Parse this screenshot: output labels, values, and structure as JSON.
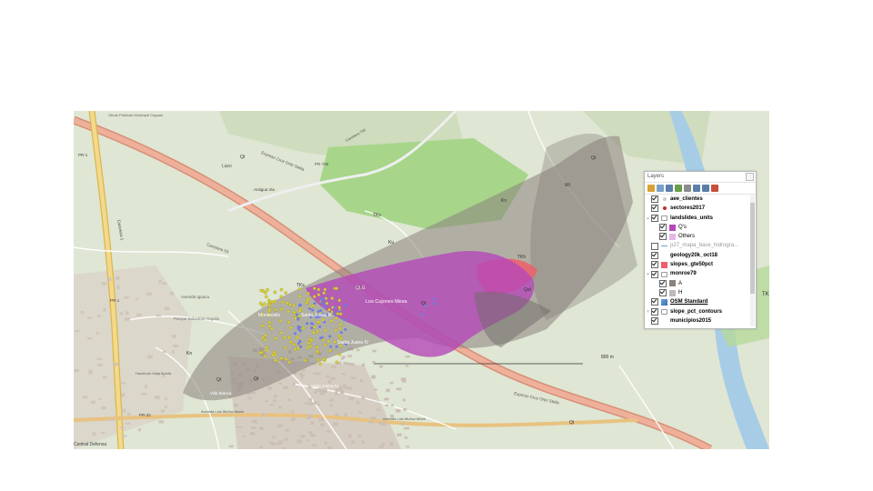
{
  "map": {
    "place_labels": [
      {
        "text": "Lazo"
      },
      {
        "text": "Antigua Via"
      },
      {
        "text": "Carretera 53"
      },
      {
        "text": "Expreso Cruz Ortiz Stella"
      },
      {
        "text": "Expreso Cruz Ortiz Stella"
      },
      {
        "text": "Avenida Iguaca"
      },
      {
        "text": "Parque Industrial Anguila"
      },
      {
        "text": "Montecielo"
      },
      {
        "text": "Santa Juana III"
      },
      {
        "text": "Santa Juana IV"
      },
      {
        "text": "Santa Juana Fy"
      },
      {
        "text": "Villa Blanca"
      },
      {
        "text": "Avenida Luis Muñoz Marín"
      },
      {
        "text": "Avenida Luis Muñoz Marín"
      },
      {
        "text": "PR-1"
      },
      {
        "text": "PR-1"
      },
      {
        "text": "PR-32"
      },
      {
        "text": "PR-796"
      },
      {
        "text": "Carretera 1"
      },
      {
        "text": "Central Defensa"
      },
      {
        "text": "Hacienda Vista Bonita"
      },
      {
        "text": "Carretera 796"
      },
      {
        "text": "Obras Públicas Municipal Caguas"
      }
    ],
    "geology_labels": [
      {
        "text": "Qt"
      },
      {
        "text": "Qt"
      },
      {
        "text": "Qt"
      },
      {
        "text": "Qt"
      },
      {
        "text": "Qt"
      },
      {
        "text": "TKs"
      },
      {
        "text": "Ku"
      },
      {
        "text": "Kn"
      },
      {
        "text": "Kn"
      },
      {
        "text": "TKh"
      },
      {
        "text": "Qal"
      },
      {
        "text": "Wi"
      },
      {
        "text": "TKG"
      },
      {
        "text": "TKs"
      },
      {
        "text": "Qt"
      }
    ],
    "landslide_labels": [
      {
        "text": "Los Cujones Mesa"
      },
      {
        "text": "QLG"
      }
    ],
    "scale_label": "800 m",
    "colors": {
      "base": "#dfe6d3",
      "forest": "#8fc46e",
      "road": "#e9a98a",
      "highway": "#f2c983",
      "monroe_grey": "#8f8782",
      "landslide_magenta": "#b549b9",
      "slope_red": "#ef5f6a",
      "building": "#d4cac0",
      "water": "#a7cde6",
      "dots_yellow": "#dcd23a",
      "dots_blue": "#6f7ee0"
    }
  },
  "layers_panel": {
    "title": "Layers",
    "toolbar_icons": [
      "open-layer-styling-icon",
      "add-group-icon",
      "manage-visibility-icon",
      "filter-legend-icon",
      "filter-expression-icon",
      "expand-all-icon",
      "collapse-all-icon",
      "remove-layer-icon"
    ],
    "rows": [
      {
        "label": "aee_clientes",
        "checked": true,
        "indent": 0,
        "expander": "",
        "symbol": "point-grey",
        "style": "bold"
      },
      {
        "label": "sectores2017",
        "checked": true,
        "indent": 0,
        "expander": "",
        "symbol": "point-red",
        "style": "bold"
      },
      {
        "label": "landslides_units",
        "checked": true,
        "indent": 0,
        "expander": "v",
        "symbol": "group",
        "style": "bold"
      },
      {
        "label": "Q's",
        "checked": true,
        "indent": 1,
        "expander": "",
        "symbol": "fill-magenta",
        "style": "sub"
      },
      {
        "label": "Others",
        "checked": true,
        "indent": 1,
        "expander": "",
        "symbol": "fill-pink",
        "style": "sub"
      },
      {
        "label": "p27_mapa_base_hidrogra...",
        "checked": false,
        "indent": 0,
        "expander": "",
        "symbol": "line-blue",
        "style": "faded"
      },
      {
        "label": "geology20k_oct18",
        "checked": true,
        "indent": 0,
        "expander": "",
        "symbol": "none",
        "style": "bold"
      },
      {
        "label": "slopes_gte50pct",
        "checked": true,
        "indent": 0,
        "expander": "",
        "symbol": "fill-red",
        "style": "bold"
      },
      {
        "label": "monroe79",
        "checked": true,
        "indent": 0,
        "expander": "v",
        "symbol": "group",
        "style": "bold"
      },
      {
        "label": "A",
        "checked": true,
        "indent": 1,
        "expander": "",
        "symbol": "fill-darkgrey",
        "style": "sub"
      },
      {
        "label": "H",
        "checked": true,
        "indent": 1,
        "expander": "",
        "symbol": "fill-grey",
        "style": "sub"
      },
      {
        "label": "OSM Standard",
        "checked": true,
        "indent": 0,
        "expander": "",
        "symbol": "osm",
        "style": "bold-underline"
      },
      {
        "label": "slope_pct_contours",
        "checked": true,
        "indent": 0,
        "expander": ">",
        "symbol": "group",
        "style": "bold"
      },
      {
        "label": "municipios2015",
        "checked": true,
        "indent": 0,
        "expander": "",
        "symbol": "none",
        "style": "bold"
      }
    ]
  },
  "edge_label": "TK"
}
